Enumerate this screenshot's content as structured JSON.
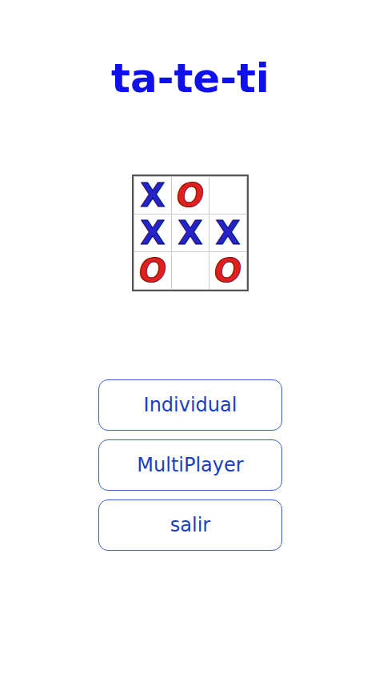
{
  "title": "ta-te-ti",
  "board": {
    "cells": [
      {
        "mark": "X"
      },
      {
        "mark": "O"
      },
      {
        "mark": ""
      },
      {
        "mark": "X"
      },
      {
        "mark": "X"
      },
      {
        "mark": "X"
      },
      {
        "mark": "O"
      },
      {
        "mark": ""
      },
      {
        "mark": "O"
      }
    ]
  },
  "menu": {
    "buttons": [
      "Individual",
      "MultiPlayer",
      "salir"
    ]
  }
}
